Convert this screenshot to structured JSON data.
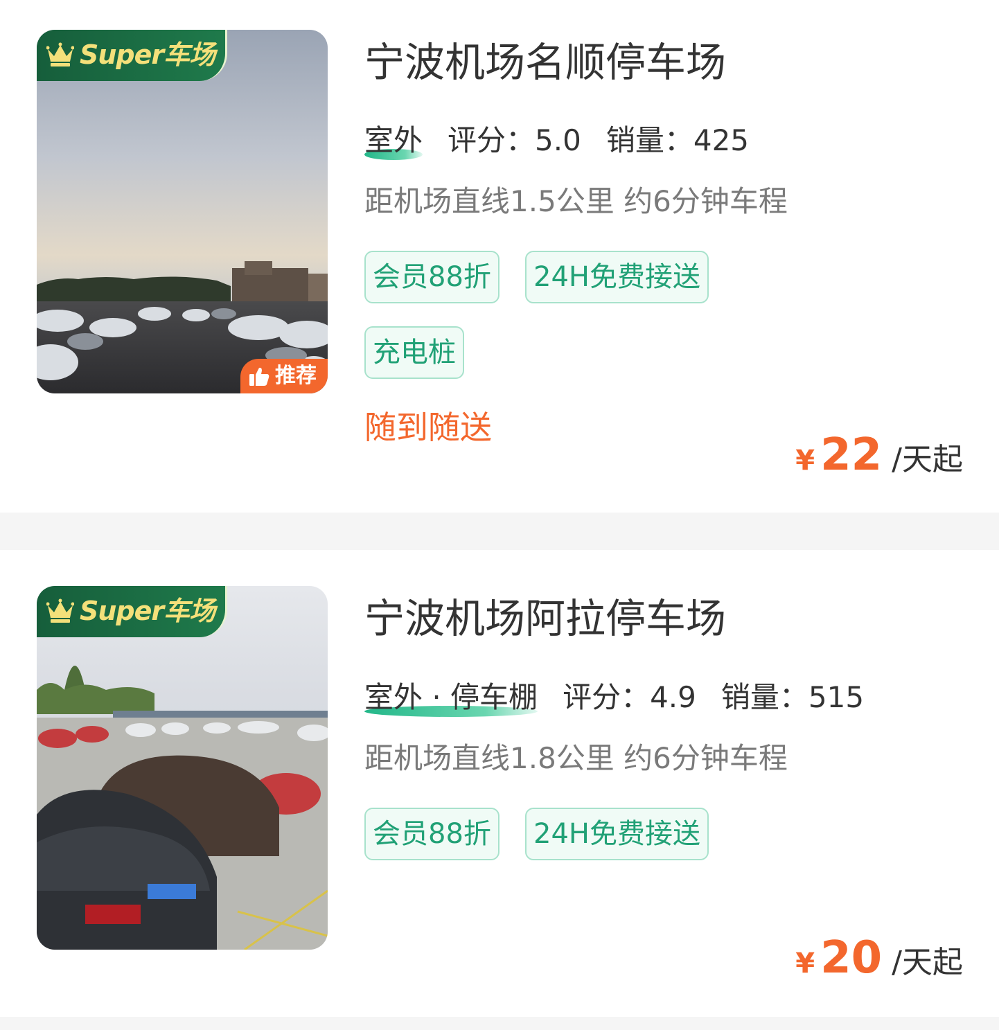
{
  "listings": [
    {
      "badge": "Super车场",
      "recommend_label": "推荐",
      "title": "宁波机场名顺停车场",
      "type": "室外",
      "rating_label": "评分：",
      "rating": "5.0",
      "sales_label": "销量：",
      "sales": "425",
      "distance": "距机场直线1.5公里 约6分钟车程",
      "tags": [
        "会员88折",
        "24H免费接送",
        "充电桩"
      ],
      "slogan": "随到随送",
      "currency": "¥",
      "price": "22",
      "price_unit": "/天起"
    },
    {
      "badge": "Super车场",
      "title": "宁波机场阿拉停车场",
      "type": "室外 · 停车棚",
      "rating_label": "评分：",
      "rating": "4.9",
      "sales_label": "销量：",
      "sales": "515",
      "distance": "距机场直线1.8公里 约6分钟车程",
      "tags": [
        "会员88折",
        "24H免费接送"
      ],
      "currency": "¥",
      "price": "20",
      "price_unit": "/天起"
    }
  ],
  "colors": {
    "accent_green": "#21a176",
    "badge_green": "#165e3b",
    "badge_gold": "#f4e07a",
    "price_orange": "#f3672d",
    "page_bg": "#f5f5f5"
  },
  "icons": {
    "crown": "crown-icon",
    "recommend": "thumbs-up-icon"
  }
}
